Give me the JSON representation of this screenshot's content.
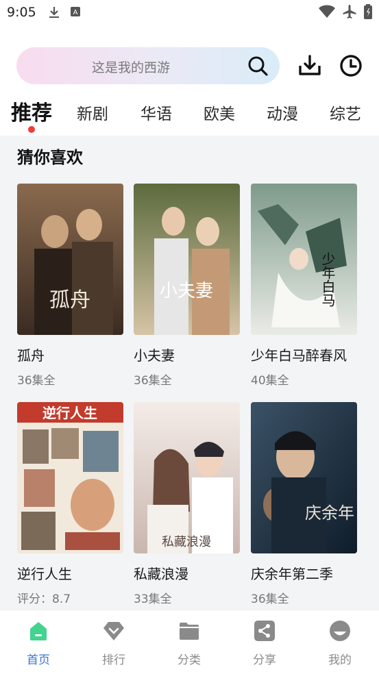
{
  "status_bar": {
    "time": "9:05",
    "left_icons": [
      "download-icon",
      "keyboard-icon"
    ],
    "right_icons": [
      "wifi-icon",
      "airplane-icon",
      "battery-icon"
    ]
  },
  "search": {
    "placeholder": "这是我的西游",
    "search_icon": "search-icon",
    "download_icon": "download-icon",
    "history_icon": "history-icon"
  },
  "tabs": [
    {
      "label": "推荐",
      "active": true
    },
    {
      "label": "新剧",
      "active": false
    },
    {
      "label": "华语",
      "active": false
    },
    {
      "label": "欧美",
      "active": false
    },
    {
      "label": "动漫",
      "active": false
    },
    {
      "label": "综艺",
      "active": false
    }
  ],
  "section": {
    "title": "猜你喜欢"
  },
  "cards": [
    {
      "title": "孤舟",
      "subtitle": "36集全",
      "poster_text": "孤舟",
      "colors": [
        "#3a2b22",
        "#8a6a4e"
      ]
    },
    {
      "title": "小夫妻",
      "subtitle": "36集全",
      "poster_text": "小夫妻",
      "colors": [
        "#5c6b3d",
        "#d6c4a6"
      ]
    },
    {
      "title": "少年白马醉春风",
      "subtitle": "40集全",
      "poster_text": "少年白马",
      "colors": [
        "#7e9a8a",
        "#e9ece6"
      ]
    },
    {
      "title": "逆行人生",
      "subtitle": "评分：8.7",
      "poster_text": "逆行人生",
      "colors": [
        "#c23b2c",
        "#f1e9dc"
      ]
    },
    {
      "title": "私藏浪漫",
      "subtitle": "33集全",
      "poster_text": "私藏浪漫",
      "colors": [
        "#c9b6ae",
        "#f4ece8"
      ]
    },
    {
      "title": "庆余年第二季",
      "subtitle": "36集全",
      "poster_text": "庆余年",
      "colors": [
        "#0f1d2a",
        "#3b5266"
      ]
    }
  ],
  "bottom_nav": [
    {
      "label": "首页",
      "icon": "home-icon",
      "active": true
    },
    {
      "label": "排行",
      "icon": "ranking-icon",
      "active": false
    },
    {
      "label": "分类",
      "icon": "folder-icon",
      "active": false
    },
    {
      "label": "分享",
      "icon": "share-icon",
      "active": false
    },
    {
      "label": "我的",
      "icon": "profile-icon",
      "active": false
    }
  ],
  "theme": {
    "accent": "#3a74d8",
    "active_home": "#41d38f",
    "indicator": "#f23c3c",
    "inactive_icon": "#8a8a8a"
  }
}
